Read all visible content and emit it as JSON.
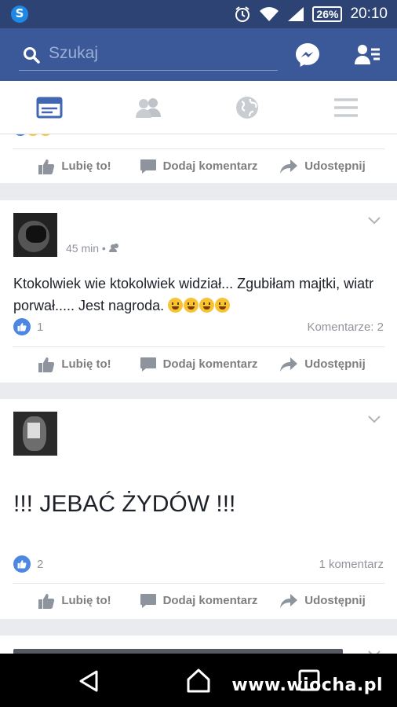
{
  "status_bar": {
    "battery": "26%",
    "time": "20:10"
  },
  "search": {
    "placeholder": "Szukaj"
  },
  "tabs": [
    {
      "name": "news-feed",
      "active": true
    },
    {
      "name": "friends"
    },
    {
      "name": "notifications"
    },
    {
      "name": "menu"
    }
  ],
  "actions": {
    "like": "Lubię to!",
    "comment": "Dodaj komentarz",
    "share": "Udostępnij"
  },
  "posts": [
    {
      "time": "45 min",
      "dot": "•",
      "text": "Ktokolwiek wie ktokolwiek widział... Zgubiłam majtki, wiatr porwał..... Jest nagroda.",
      "emoji_count": 4,
      "likes": "1",
      "comments": "Komentarze: 2"
    },
    {
      "text": "!!! JEBAĆ ŻYDÓW  !!!",
      "likes": "2",
      "comments": "1 komentarz"
    }
  ],
  "watermark": "www.wiocha.pl",
  "colors": {
    "facebook_blue": "#3b5998",
    "status_bar": "#2d4373",
    "like_blue": "#4e86e4"
  }
}
